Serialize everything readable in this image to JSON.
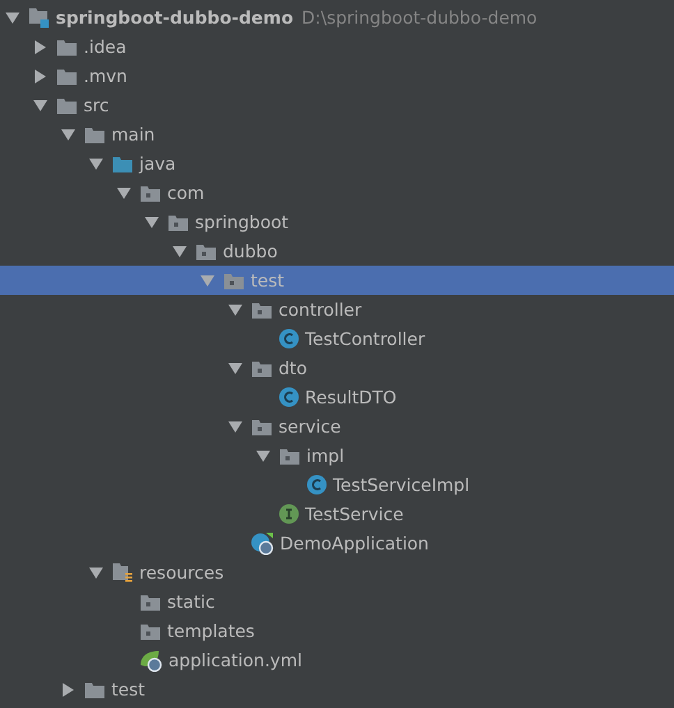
{
  "tree": [
    {
      "label": "springboot-dubbo-demo",
      "path": "D:\\springboot-dubbo-demo",
      "kind": "module",
      "expanded": true,
      "selected": false,
      "children": [
        {
          "label": ".idea",
          "kind": "folder",
          "expanded": false,
          "selected": false
        },
        {
          "label": ".mvn",
          "kind": "folder",
          "expanded": false,
          "selected": false
        },
        {
          "label": "src",
          "kind": "folder",
          "expanded": true,
          "selected": false,
          "children": [
            {
              "label": "main",
              "kind": "folder",
              "expanded": true,
              "selected": false,
              "children": [
                {
                  "label": "java",
                  "kind": "source",
                  "expanded": true,
                  "selected": false,
                  "children": [
                    {
                      "label": "com",
                      "kind": "package",
                      "expanded": true,
                      "selected": false,
                      "children": [
                        {
                          "label": "springboot",
                          "kind": "package",
                          "expanded": true,
                          "selected": false,
                          "children": [
                            {
                              "label": "dubbo",
                              "kind": "package",
                              "expanded": true,
                              "selected": false,
                              "children": [
                                {
                                  "label": "test",
                                  "kind": "package",
                                  "expanded": true,
                                  "selected": true,
                                  "children": [
                                    {
                                      "label": "controller",
                                      "kind": "package",
                                      "expanded": true,
                                      "selected": false,
                                      "children": [
                                        {
                                          "label": "TestController",
                                          "kind": "class",
                                          "selected": false
                                        }
                                      ]
                                    },
                                    {
                                      "label": "dto",
                                      "kind": "package",
                                      "expanded": true,
                                      "selected": false,
                                      "children": [
                                        {
                                          "label": "ResultDTO",
                                          "kind": "class",
                                          "selected": false
                                        }
                                      ]
                                    },
                                    {
                                      "label": "service",
                                      "kind": "package",
                                      "expanded": true,
                                      "selected": false,
                                      "children": [
                                        {
                                          "label": "impl",
                                          "kind": "package",
                                          "expanded": true,
                                          "selected": false,
                                          "children": [
                                            {
                                              "label": "TestServiceImpl",
                                              "kind": "class",
                                              "selected": false
                                            }
                                          ]
                                        },
                                        {
                                          "label": "TestService",
                                          "kind": "interface",
                                          "selected": false
                                        }
                                      ]
                                    },
                                    {
                                      "label": "DemoApplication",
                                      "kind": "spring-class",
                                      "selected": false
                                    }
                                  ]
                                }
                              ]
                            }
                          ]
                        }
                      ]
                    }
                  ]
                },
                {
                  "label": "resources",
                  "kind": "resources",
                  "expanded": true,
                  "selected": false,
                  "children": [
                    {
                      "label": "static",
                      "kind": "package",
                      "selected": false
                    },
                    {
                      "label": "templates",
                      "kind": "package",
                      "selected": false
                    },
                    {
                      "label": "application.yml",
                      "kind": "yml",
                      "selected": false
                    }
                  ]
                }
              ]
            },
            {
              "label": "test",
              "kind": "folder",
              "expanded": false,
              "selected": false
            }
          ]
        }
      ]
    }
  ]
}
